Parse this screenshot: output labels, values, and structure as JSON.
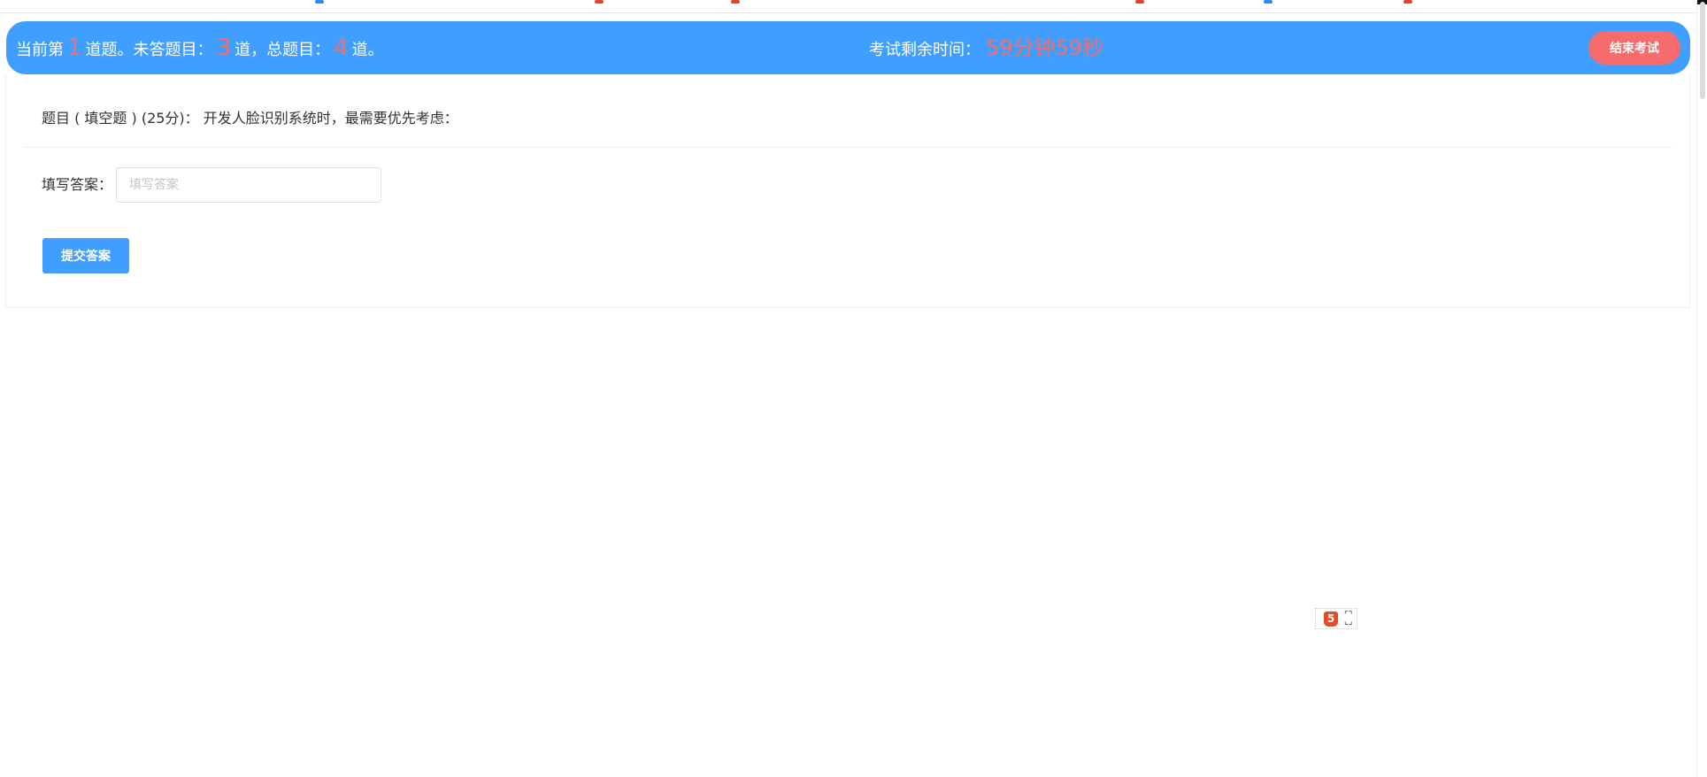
{
  "status_bar": {
    "current_prefix": "当前第",
    "current_number": "1",
    "current_suffix": "道题。未答题目：",
    "unanswered_number": "3",
    "unanswered_suffix": "道，总题目：",
    "total_number": "4",
    "total_suffix": "道。",
    "timer_label": "考试剩余时间：",
    "timer_value": "59分钟59秒",
    "end_button_label": "结束考试"
  },
  "question": {
    "title": "题目 ( 填空题 ) (25分)：  开发人脸识别系统时，最需要优先考虑：",
    "answer_label": "填写答案：",
    "answer_value": "",
    "answer_placeholder": "填写答案",
    "submit_label": "提交答案"
  },
  "widget": {
    "logo_icon": "html5-logo-icon",
    "logo_letter": "5",
    "expand_icon": "expand-icon"
  },
  "colors": {
    "primary": "#409eff",
    "danger": "#f56c6c",
    "text": "#303133",
    "border": "#dcdfe6"
  }
}
